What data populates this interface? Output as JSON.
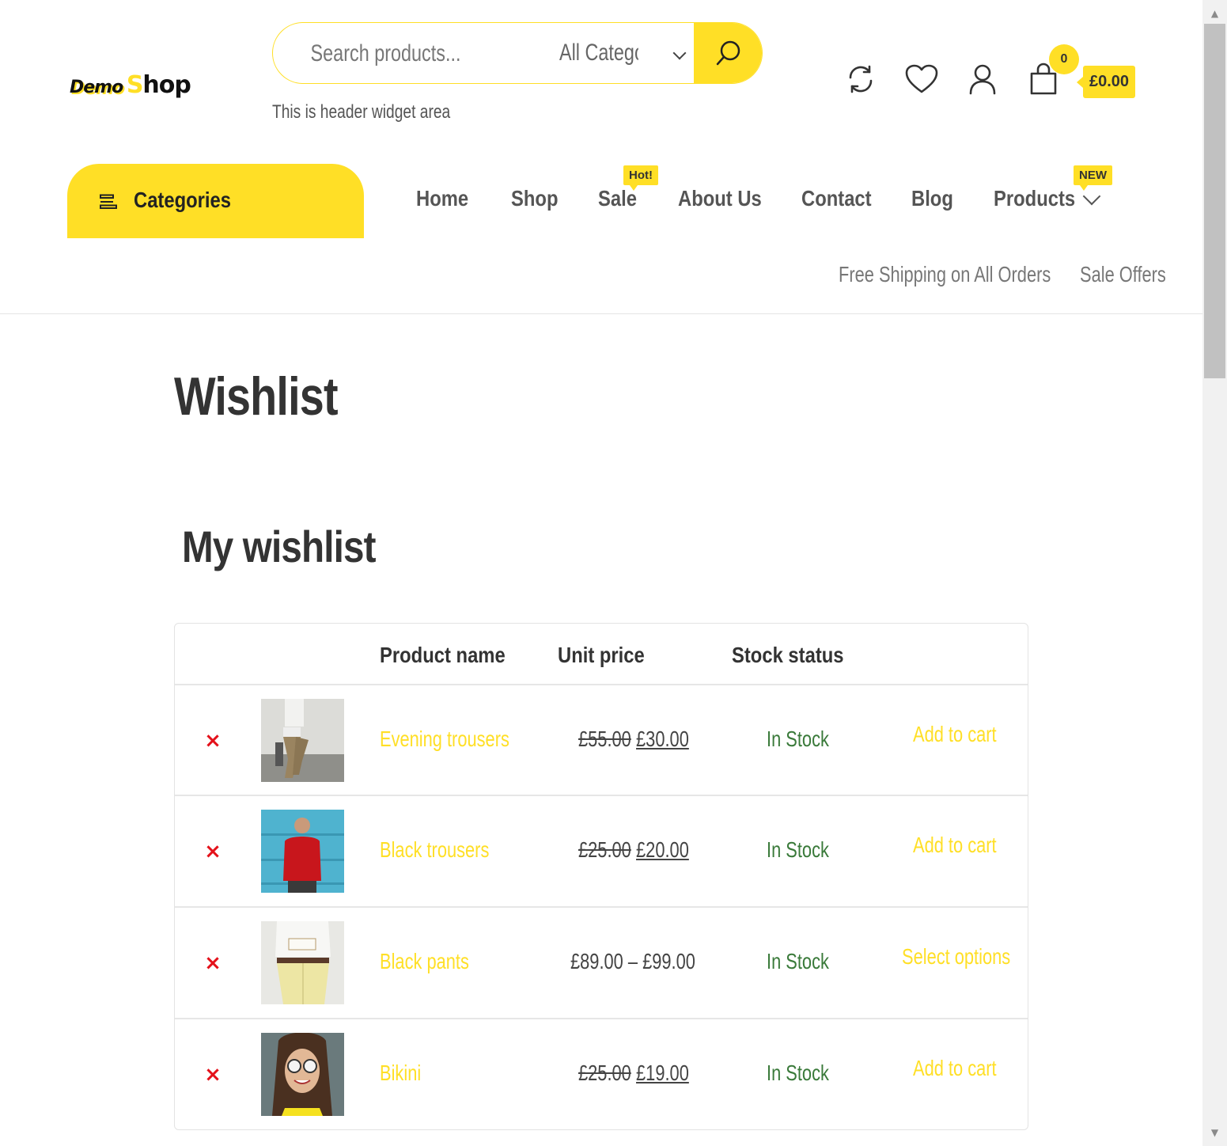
{
  "logo": {
    "part1": "Demo",
    "part2_first": "S",
    "part2_rest": "hop"
  },
  "search": {
    "placeholder": "Search products...",
    "category": "All Categories"
  },
  "header": {
    "widget_text": "This is header widget area",
    "cart_count": "0",
    "cart_total": "£0.00"
  },
  "icons": {
    "compare": "refresh-icon",
    "wishlist": "heart-icon",
    "account": "user-icon",
    "cart": "shopping-bag-icon",
    "search": "search-icon",
    "categories": "menu-icon"
  },
  "nav": {
    "categories_label": "Categories",
    "items": [
      "Home",
      "Shop",
      "Sale",
      "About Us",
      "Contact",
      "Blog",
      "Products"
    ],
    "sale_badge": "Hot!",
    "products_badge": "NEW",
    "sub_items": [
      "Free Shipping on All Orders",
      "Sale Offers"
    ]
  },
  "page": {
    "title": "Wishlist",
    "section_title": "My wishlist"
  },
  "table": {
    "headers": {
      "name": "Product name",
      "price": "Unit price",
      "stock": "Stock status"
    },
    "rows": [
      {
        "remove": "×",
        "name": "Evening trousers",
        "old_price": "£55.00",
        "price": "£30.00",
        "stock": "In Stock",
        "action": "Add to cart"
      },
      {
        "remove": "×",
        "name": "Black trousers",
        "old_price": "£25.00",
        "price": "£20.00",
        "stock": "In Stock",
        "action": "Add to cart"
      },
      {
        "remove": "×",
        "name": "Black pants",
        "price_range": "£89.00 – £99.00",
        "stock": "In Stock",
        "action": "Select options"
      },
      {
        "remove": "×",
        "name": "Bikini",
        "old_price": "£25.00",
        "price": "£19.00",
        "stock": "In Stock",
        "action": "Add to cart"
      }
    ]
  },
  "colors": {
    "accent": "#ffdf26",
    "remove": "#e4111a",
    "stock": "#3a7a3a",
    "text": "#333333"
  }
}
